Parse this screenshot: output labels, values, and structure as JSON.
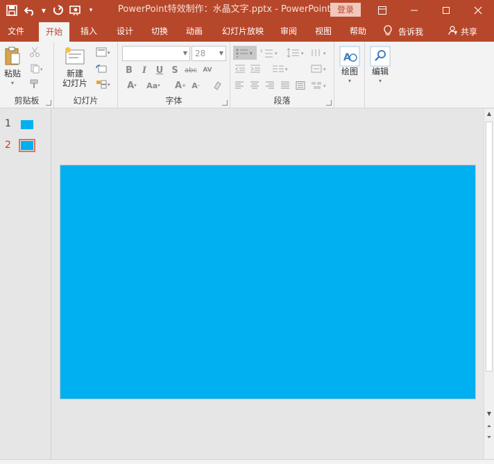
{
  "titlebar": {
    "title": "PowerPoint特效制作：水晶文字.pptx  -  PowerPoint",
    "login_label": "登录"
  },
  "tabs": [
    {
      "label": "文件"
    },
    {
      "label": "开始"
    },
    {
      "label": "插入"
    },
    {
      "label": "设计"
    },
    {
      "label": "切换"
    },
    {
      "label": "动画"
    },
    {
      "label": "幻灯片放映"
    },
    {
      "label": "审阅"
    },
    {
      "label": "视图"
    },
    {
      "label": "帮助"
    }
  ],
  "active_tab": "开始",
  "tell_me": {
    "label": "告诉我"
  },
  "share": {
    "label": "共享"
  },
  "ribbon": {
    "clipboard": {
      "label": "剪贴板",
      "paste_label": "粘贴"
    },
    "slides": {
      "label": "幻灯片",
      "new_slide_line1": "新建",
      "new_slide_line2": "幻灯片"
    },
    "font": {
      "label": "字体",
      "font_name": "",
      "font_size": "28"
    },
    "paragraph": {
      "label": "段落"
    },
    "drawing": {
      "label": "绘图"
    },
    "editing": {
      "label": "编辑"
    }
  },
  "thumbnails": [
    {
      "number": "1"
    },
    {
      "number": "2"
    }
  ],
  "colors": {
    "accent": "#b7472a",
    "slide_fill": "#00b0f0"
  }
}
